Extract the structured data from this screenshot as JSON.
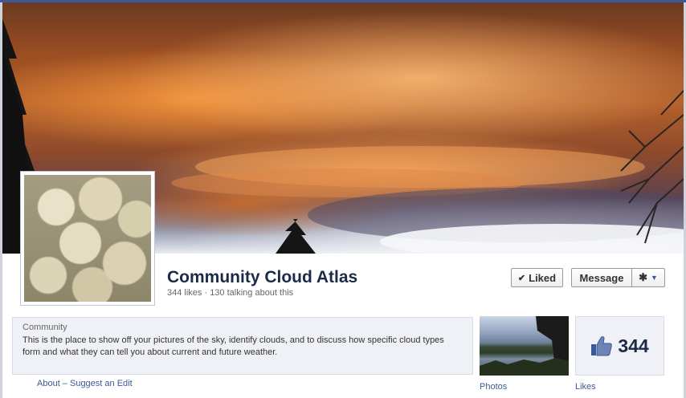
{
  "page": {
    "name": "Community Cloud Atlas",
    "stats": "344 likes · 130 talking about this",
    "category": "Community",
    "description": "This is the place to show off your pictures of the sky, identify clouds, and to discuss how specific cloud types form and what they can tell you about current and future weather."
  },
  "actions": {
    "liked_label": "Liked",
    "message_label": "Message"
  },
  "links": {
    "about": "About",
    "separator": " – ",
    "suggest_edit": "Suggest an Edit"
  },
  "apps": {
    "photos_label": "Photos",
    "likes_count": "344",
    "likes_label": "Likes"
  },
  "icons": {
    "check": "check-icon",
    "gear": "gear-icon",
    "caret": "caret-down-icon",
    "thumbs_up": "thumbs-up-icon"
  },
  "colors": {
    "brand_blue": "#3b5998",
    "link": "#3b5998",
    "title": "#1c2a47"
  }
}
